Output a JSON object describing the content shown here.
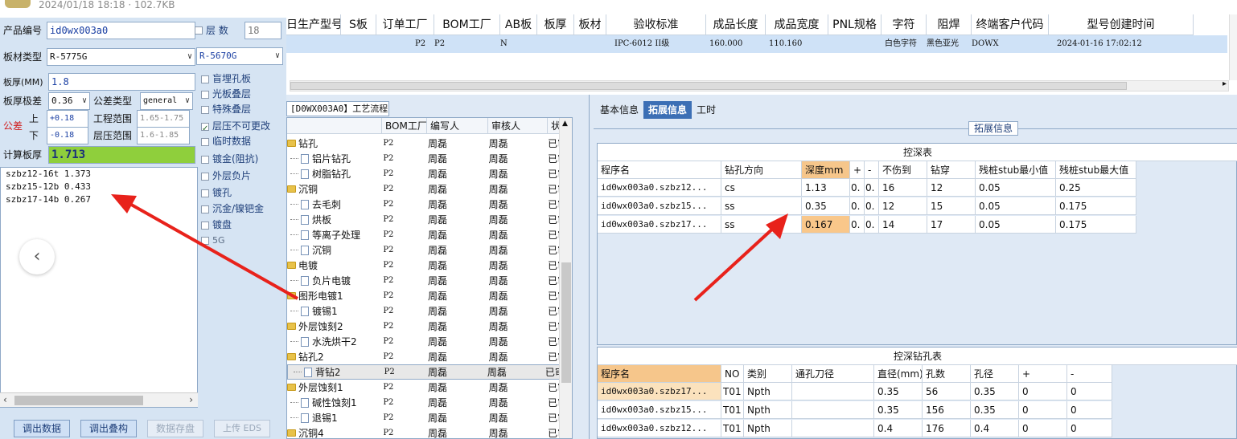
{
  "top_strip": {
    "meta": "2024/01/18 18:18 · 102.7KB"
  },
  "left": {
    "product_no_label": "产品编号",
    "product_no_value": "id0wx003a0",
    "layer_check_label": "层 数",
    "layer_value": "18",
    "board_type_label": "板材类型",
    "board_type_value": "R-5775G",
    "board_type_value2": "R-5670G",
    "thickness_label": "板厚(MM)",
    "thickness_value": "1.8",
    "tol_label": "板厚极差",
    "tol_value": "0.36",
    "tol_type_label": "公差类型",
    "tol_type_value": "general",
    "tol_red_label": "公差",
    "upper_label": "上",
    "upper_value": "+0.18",
    "lower_label": "下",
    "lower_value": "-0.18",
    "eng_range_label": "工程范围",
    "eng_range_value": "1.65-1.75",
    "layer_range_label": "层压范围",
    "layer_range_value": "1.6-1.85",
    "calc_label": "计算板厚",
    "calc_value": "1.713",
    "checkboxes": [
      {
        "label": "盲埋孔板",
        "checked": false
      },
      {
        "label": "光板叠层",
        "checked": false
      },
      {
        "label": "特殊叠层",
        "checked": false
      },
      {
        "label": "层压不可更改",
        "checked": true
      },
      {
        "label": "临时数据",
        "checked": false
      },
      {
        "label": "镀金(阻抗)",
        "checked": false
      },
      {
        "label": "外层负片",
        "checked": false
      },
      {
        "label": "镀孔",
        "checked": false
      },
      {
        "label": "沉金/镍钯金",
        "checked": false
      },
      {
        "label": "镀盘",
        "checked": false
      },
      {
        "label": "5G",
        "checked": false
      }
    ],
    "list_items": [
      {
        "name": "szbz12-16t",
        "value": "1.373"
      },
      {
        "name": "szbz15-12b",
        "value": "0.433"
      },
      {
        "name": "szbz17-14b",
        "value": "0.267"
      }
    ],
    "buttons": {
      "load_data": "调出数据",
      "load_stack": "调出叠构",
      "save": "数据存盘",
      "upload": "上传 EDS"
    }
  },
  "top_grid": {
    "headers": [
      "日生产型号",
      "S板",
      "订单工厂",
      "BOM工厂",
      "AB板",
      "板厚",
      "板材",
      "验收标准",
      "成品长度",
      "成品宽度",
      "PNL规格",
      "字符",
      "阻焊",
      "终端客户代码",
      "型号创建时间"
    ],
    "row": [
      "",
      "",
      "P2",
      "P2",
      "N",
      "",
      "",
      "IPC-6012 II级",
      "160.000",
      "110.160",
      "",
      "白色字符",
      "黑色亚光",
      "DOWX",
      "2024-01-16 17:02:12"
    ]
  },
  "mid": {
    "tab_label": "[D0WX003A0】工艺流程",
    "headers": [
      "",
      "BOM工厂",
      "编写人",
      "审核人",
      "状态"
    ],
    "rows": [
      {
        "name": "钻孔",
        "type": "folder",
        "bom": "P2",
        "editor": "周磊",
        "reviewer": "周磊",
        "status": "已审核"
      },
      {
        "name": "铝片钻孔",
        "type": "doc",
        "bom": "P2",
        "editor": "周磊",
        "reviewer": "周磊",
        "status": "已审核"
      },
      {
        "name": "树脂钻孔",
        "type": "doc",
        "bom": "P2",
        "editor": "周磊",
        "reviewer": "周磊",
        "status": "已审核"
      },
      {
        "name": "沉铜",
        "type": "folder",
        "bom": "P2",
        "editor": "周磊",
        "reviewer": "周磊",
        "status": "已审核"
      },
      {
        "name": "去毛刺",
        "type": "doc",
        "bom": "P2",
        "editor": "周磊",
        "reviewer": "周磊",
        "status": "已审核"
      },
      {
        "name": "烘板",
        "type": "doc",
        "bom": "P2",
        "editor": "周磊",
        "reviewer": "周磊",
        "status": "已审核"
      },
      {
        "name": "等离子处理",
        "type": "doc",
        "bom": "P2",
        "editor": "周磊",
        "reviewer": "周磊",
        "status": "已审核"
      },
      {
        "name": "沉铜",
        "type": "doc",
        "bom": "P2",
        "editor": "周磊",
        "reviewer": "周磊",
        "status": "已审核"
      },
      {
        "name": "电镀",
        "type": "folder",
        "bom": "P2",
        "editor": "周磊",
        "reviewer": "周磊",
        "status": "已审核"
      },
      {
        "name": "负片电镀",
        "type": "doc",
        "bom": "P2",
        "editor": "周磊",
        "reviewer": "周磊",
        "status": "已审核"
      },
      {
        "name": "图形电镀1",
        "type": "folder",
        "bom": "P2",
        "editor": "周磊",
        "reviewer": "周磊",
        "status": "已审核"
      },
      {
        "name": "镀锡1",
        "type": "doc",
        "bom": "P2",
        "editor": "周磊",
        "reviewer": "周磊",
        "status": "已审核"
      },
      {
        "name": "外层蚀刻2",
        "type": "folder",
        "bom": "P2",
        "editor": "周磊",
        "reviewer": "周磊",
        "status": "已审核"
      },
      {
        "name": "水洗烘干2",
        "type": "doc",
        "bom": "P2",
        "editor": "周磊",
        "reviewer": "周磊",
        "status": "已审核"
      },
      {
        "name": "钻孔2",
        "type": "folder",
        "bom": "P2",
        "editor": "周磊",
        "reviewer": "周磊",
        "status": "已审核"
      },
      {
        "name": "背钻2",
        "type": "doc",
        "bom": "P2",
        "editor": "周磊",
        "reviewer": "周磊",
        "status": "已审核",
        "selected": true
      },
      {
        "name": "外层蚀刻1",
        "type": "folder",
        "bom": "P2",
        "editor": "周磊",
        "reviewer": "周磊",
        "status": "已审核"
      },
      {
        "name": "碱性蚀刻1",
        "type": "doc",
        "bom": "P2",
        "editor": "周磊",
        "reviewer": "周磊",
        "status": "已审核"
      },
      {
        "name": "退锡1",
        "type": "doc",
        "bom": "P2",
        "editor": "周磊",
        "reviewer": "周磊",
        "status": "已审核"
      },
      {
        "name": "沉铜4",
        "type": "folder",
        "bom": "P2",
        "editor": "周磊",
        "reviewer": "周磊",
        "status": "已审核"
      }
    ]
  },
  "right": {
    "tabs": [
      "基本信息",
      "拓展信息",
      "工时"
    ],
    "active_tab": "拓展信息",
    "section_title": "拓展信息",
    "table1": {
      "title": "控深表",
      "headers": [
        "程序名",
        "钻孔方向",
        "深度mm",
        "+",
        "-",
        "不伤到",
        "钻穿",
        "残桩stub最小值",
        "残桩stub最大值"
      ],
      "rows": [
        [
          "id0wx003a0.szbz12...",
          "cs",
          "1.13",
          "0.",
          "0.",
          "16",
          "12",
          "0.05",
          "0.25"
        ],
        [
          "id0wx003a0.szbz15...",
          "ss",
          "0.35",
          "0.",
          "0.",
          "12",
          "15",
          "0.05",
          "0.175"
        ],
        [
          "id0wx003a0.szbz17...",
          "ss",
          "0.167",
          "0.",
          "0.",
          "14",
          "17",
          "0.05",
          "0.175"
        ]
      ]
    },
    "table2": {
      "title": "控深钻孔表",
      "headers": [
        "程序名",
        "NO",
        "类别",
        "通孔刀径",
        "直径(mm)",
        "孔数",
        "孔径",
        "+",
        "-"
      ],
      "rows": [
        [
          "id0wx003a0.szbz17...",
          "T01",
          "Npth",
          "",
          "0.35",
          "56",
          "0.35",
          "0",
          "0"
        ],
        [
          "id0wx003a0.szbz15...",
          "T01",
          "Npth",
          "",
          "0.35",
          "156",
          "0.35",
          "0",
          "0"
        ],
        [
          "id0wx003a0.szbz12...",
          "T01",
          "Npth",
          "",
          "0.4",
          "176",
          "0.4",
          "0",
          "0"
        ]
      ]
    }
  },
  "colors": {
    "accent": "#3c6fb5",
    "arrow": "#e8221b",
    "highlight": "#f6c68b",
    "calc_bg": "#8fcf3c"
  }
}
